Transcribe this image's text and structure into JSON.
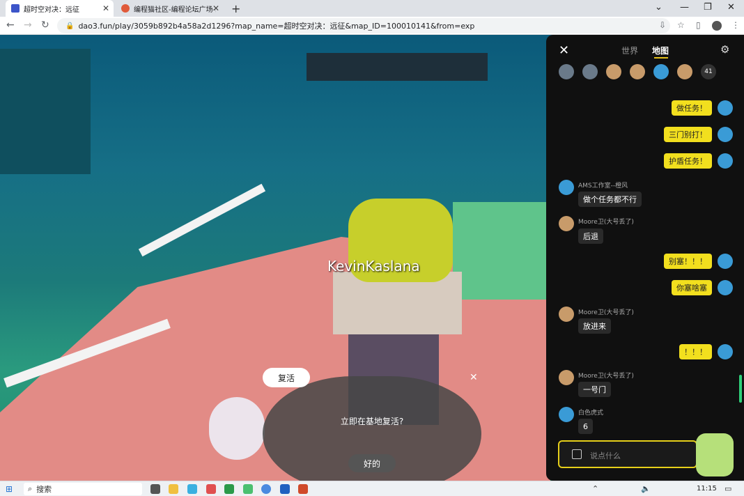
{
  "browser": {
    "tabs": [
      {
        "title": "超时空对决：远征",
        "active": true
      },
      {
        "title": "编程猫社区-编程论坛广场-编…",
        "active": false
      }
    ],
    "url": "dao3.fun/play/3059b892b4a58a2d1296?map_name=超时空对决：远征&map_ID=100010141&from=exp"
  },
  "game": {
    "player_name": "KevinKaslana",
    "revive": {
      "tag": "复活",
      "message": "立即在基地复活?",
      "confirm": "好的"
    }
  },
  "chat": {
    "tabs": [
      "世界",
      "地图"
    ],
    "active_tab": "地图",
    "online_count": "41",
    "messages": [
      {
        "dir": "out",
        "text": "做任务！"
      },
      {
        "dir": "out",
        "text": "三门别打！"
      },
      {
        "dir": "out",
        "text": "护盾任务！"
      },
      {
        "dir": "in",
        "name": "AMS工作室--橙风",
        "text": "做个任务都不行"
      },
      {
        "dir": "in",
        "name": "Moore卫(大号丢了)",
        "text": "后退"
      },
      {
        "dir": "out",
        "text": "别塞！！！"
      },
      {
        "dir": "out",
        "text": "你塞啥塞"
      },
      {
        "dir": "in",
        "name": "Moore卫(大号丢了)",
        "text": "放进来"
      },
      {
        "dir": "out",
        "text": "！！！"
      },
      {
        "dir": "in",
        "name": "Moore卫(大号丢了)",
        "text": "一号门"
      },
      {
        "dir": "in",
        "name": "白色虎式",
        "text": "6"
      }
    ],
    "input_placeholder": "说点什么"
  },
  "taskbar": {
    "search_label": "搜索",
    "time": "11:15"
  }
}
